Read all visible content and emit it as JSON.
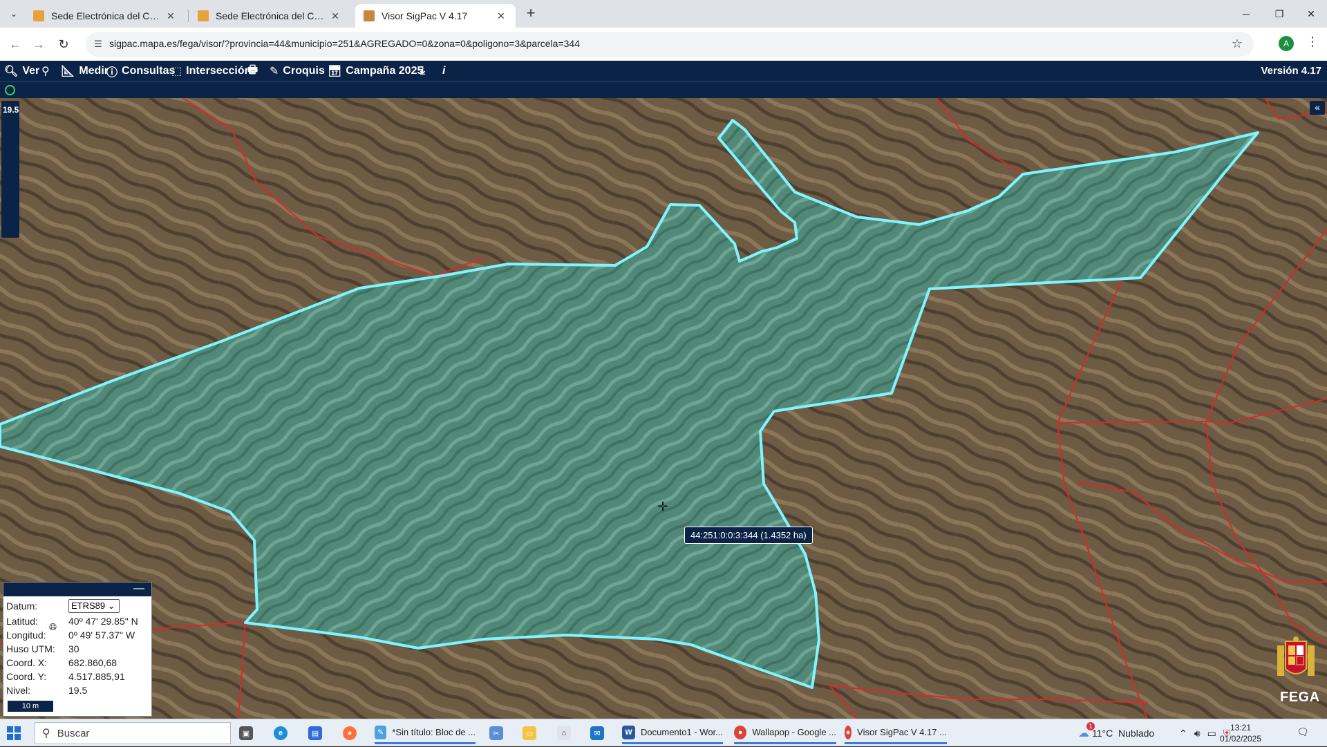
{
  "browser": {
    "tabs": [
      {
        "label": "Sede Electrónica del Catastro -",
        "active": false
      },
      {
        "label": "Sede Electrónica del Catastro",
        "active": false
      },
      {
        "label": "Visor SigPac V 4.17",
        "active": true
      }
    ],
    "url": "sigpac.mapa.es/fega/visor/?provincia=44&municipio=251&AGREGADO=0&zona=0&poligono=3&parcela=344",
    "profile_initial": "A"
  },
  "toolbar": {
    "ver": "Ver",
    "medir": "Medir",
    "consultas": "Consultas",
    "interseccion": "Intersección",
    "croquis": "Croquis",
    "campana": "Campaña 2025",
    "version": "Versión 4.17"
  },
  "map": {
    "zoom_level": "19.5",
    "parcel_label": "44:251:0:0:3:344 (1.4352 ha)",
    "logo_text": "FEGA",
    "colors": {
      "parcel_fill": "#6ab7a8",
      "parcel_stroke": "#7ff5ff",
      "boundary": "#d62a2a",
      "toolbar": "#0b2346"
    }
  },
  "coords": {
    "datum_label": "Datum:",
    "datum_value": "ETRS89",
    "lat_label": "Latitud:",
    "lat_value": "40º 47' 29.85\" N",
    "lon_label": "Longitud:",
    "lon_value": "0º 49' 57.37\" W",
    "huso_label": "Huso UTM:",
    "huso_value": "30",
    "x_label": "Coord. X:",
    "x_value": "682.860,68",
    "y_label": "Coord. Y:",
    "y_value": "4.517.885,91",
    "nivel_label": "Nivel:",
    "nivel_value": "19.5",
    "scale": "10 m"
  },
  "taskbar": {
    "search_placeholder": "Buscar",
    "apps": [
      {
        "label": "*Sin título: Bloc de ...",
        "icon": "notepad-icon"
      },
      {
        "label": "Documento1 - Wor...",
        "icon": "word-icon"
      },
      {
        "label": "Wallapop - Google ...",
        "icon": "chrome-icon"
      },
      {
        "label": "Visor SigPac V 4.17 ...",
        "icon": "chrome-icon"
      }
    ],
    "weather": "11°C  Nublado",
    "weather_badge": "1",
    "time": "13:21",
    "date": "01/02/2025"
  }
}
